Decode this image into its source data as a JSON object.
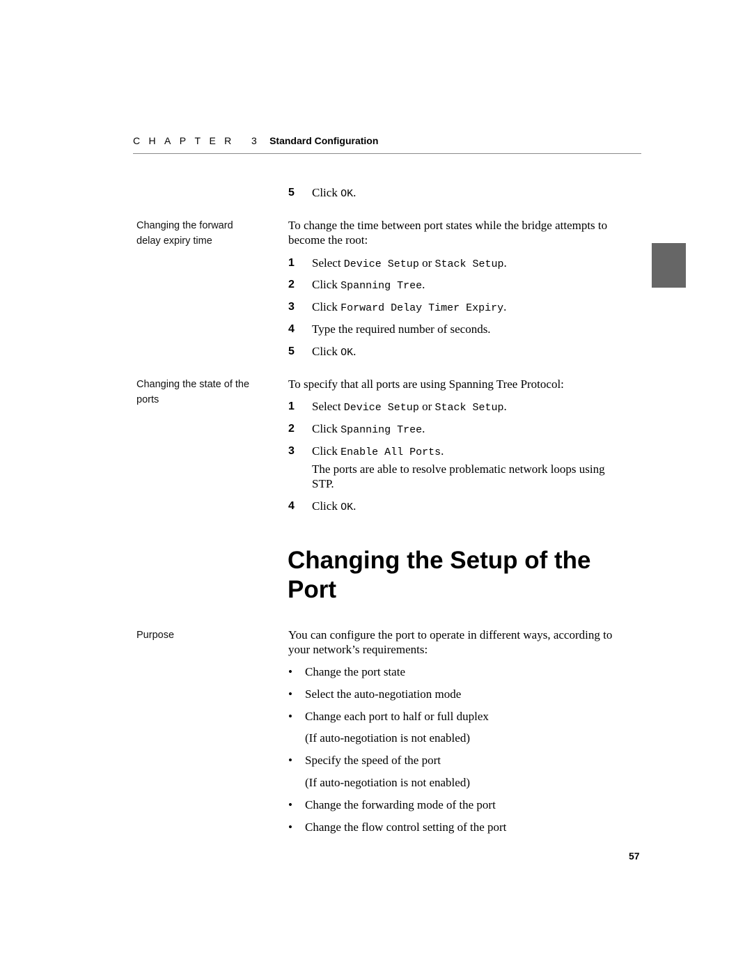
{
  "header": {
    "chapter_label": "CHAPTER 3",
    "chapter_title": "Standard Configuration"
  },
  "intro_step": {
    "num": "5",
    "prefix": "Click ",
    "code": "OK",
    "suffix": "."
  },
  "sections": [
    {
      "side_label": [
        "Changing the forward",
        "delay expiry time"
      ],
      "intro": [
        "To change the time between port states while the bridge attempts to",
        "become the root:"
      ],
      "steps": [
        {
          "num": "1",
          "prefix": "Select ",
          "code": "Device Setup",
          "mid": " or ",
          "code2": "Stack Setup",
          "suffix": "."
        },
        {
          "num": "2",
          "prefix": "Click ",
          "code": "Spanning Tree",
          "suffix": "."
        },
        {
          "num": "3",
          "prefix": "Click ",
          "code": "Forward Delay Timer Expiry",
          "suffix": "."
        },
        {
          "num": "4",
          "text": "Type the required number of seconds."
        },
        {
          "num": "5",
          "prefix": "Click ",
          "code": "OK",
          "suffix": "."
        }
      ]
    },
    {
      "side_label": [
        "Changing the state of the",
        "ports"
      ],
      "intro": [
        "To specify that all ports are using Spanning Tree Protocol:"
      ],
      "steps": [
        {
          "num": "1",
          "prefix": "Select ",
          "code": "Device Setup",
          "mid": " or ",
          "code2": "Stack Setup",
          "suffix": "."
        },
        {
          "num": "2",
          "prefix": "Click ",
          "code": "Spanning Tree",
          "suffix": "."
        },
        {
          "num": "3",
          "prefix": "Click ",
          "code": "Enable All Ports",
          "suffix": "."
        },
        {
          "num": "4",
          "prefix": "Click ",
          "code": "OK",
          "suffix": "."
        }
      ],
      "note": [
        "The ports are able to resolve problematic network loops using",
        "STP."
      ]
    }
  ],
  "heading": [
    "Changing the Setup of the",
    "Port"
  ],
  "purpose": {
    "side_label": "Purpose",
    "intro": [
      "You can configure the port to operate in different ways, according to",
      "your network’s requirements:"
    ],
    "bullet_char": "•",
    "bullets": [
      {
        "text": "Change the port state"
      },
      {
        "text": "Select the auto-negotiation mode"
      },
      {
        "text": "Change each port to half or full duplex",
        "sub": "(If auto-negotiation is not enabled)"
      },
      {
        "text": "Specify the speed of the port",
        "sub": "(If auto-negotiation is not enabled)"
      },
      {
        "text": "Change the forwarding mode of the port"
      },
      {
        "text": "Change the flow control setting of the port"
      }
    ]
  },
  "page_number": "57"
}
